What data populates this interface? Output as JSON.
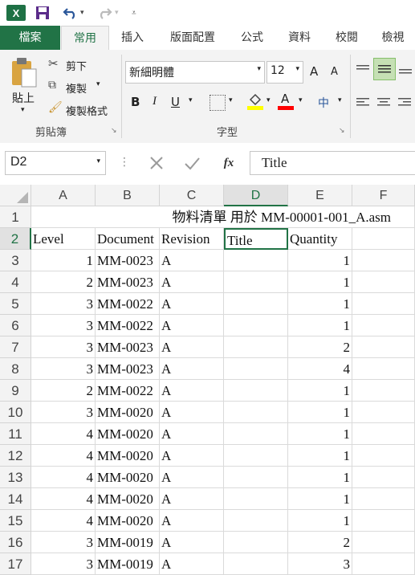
{
  "quick_access": {
    "logo": "X",
    "save_icon": "save-icon",
    "undo_icon": "undo-icon",
    "redo_icon": "redo-icon"
  },
  "tabs": [
    {
      "label": "檔案"
    },
    {
      "label": "常用"
    },
    {
      "label": "插入"
    },
    {
      "label": "版面配置"
    },
    {
      "label": "公式"
    },
    {
      "label": "資料"
    },
    {
      "label": "校閱"
    },
    {
      "label": "檢視"
    }
  ],
  "ribbon": {
    "clipboard": {
      "paste": "貼上",
      "cut": "剪下",
      "copy": "複製",
      "format_painter": "複製格式",
      "group_label": "剪貼簿"
    },
    "font": {
      "name": "新細明體",
      "size": "12",
      "bold": "B",
      "italic": "I",
      "underline": "U",
      "group_label": "字型",
      "phonetic": "中",
      "grow": "A",
      "shrink": "A",
      "font_color": "A"
    }
  },
  "formula_bar": {
    "name_box": "D2",
    "fx": "fx",
    "value": "Title"
  },
  "columns": [
    "A",
    "B",
    "C",
    "D",
    "E",
    "F"
  ],
  "title_row": "物料清單 用於 MM-00001-001_A.asm",
  "headers": [
    "Level",
    "Document",
    "Revision",
    "Title",
    "Quantity"
  ],
  "rows": [
    {
      "n": "3",
      "level": "1",
      "doc": "MM-0023",
      "rev": "A",
      "title": "",
      "qty": "1"
    },
    {
      "n": "4",
      "level": "2",
      "doc": "MM-0023",
      "rev": "A",
      "title": "",
      "qty": "1"
    },
    {
      "n": "5",
      "level": "3",
      "doc": "MM-0022",
      "rev": "A",
      "title": "",
      "qty": "1"
    },
    {
      "n": "6",
      "level": "3",
      "doc": "MM-0022",
      "rev": "A",
      "title": "",
      "qty": "1"
    },
    {
      "n": "7",
      "level": "3",
      "doc": "MM-0023",
      "rev": "A",
      "title": "",
      "qty": "2"
    },
    {
      "n": "8",
      "level": "3",
      "doc": "MM-0023",
      "rev": "A",
      "title": "",
      "qty": "4"
    },
    {
      "n": "9",
      "level": "2",
      "doc": "MM-0022",
      "rev": "A",
      "title": "",
      "qty": "1"
    },
    {
      "n": "10",
      "level": "3",
      "doc": "MM-0020",
      "rev": "A",
      "title": "",
      "qty": "1"
    },
    {
      "n": "11",
      "level": "4",
      "doc": "MM-0020",
      "rev": "A",
      "title": "",
      "qty": "1"
    },
    {
      "n": "12",
      "level": "4",
      "doc": "MM-0020",
      "rev": "A",
      "title": "",
      "qty": "1"
    },
    {
      "n": "13",
      "level": "4",
      "doc": "MM-0020",
      "rev": "A",
      "title": "",
      "qty": "1"
    },
    {
      "n": "14",
      "level": "4",
      "doc": "MM-0020",
      "rev": "A",
      "title": "",
      "qty": "1"
    },
    {
      "n": "15",
      "level": "4",
      "doc": "MM-0020",
      "rev": "A",
      "title": "",
      "qty": "1"
    },
    {
      "n": "16",
      "level": "3",
      "doc": "MM-0019",
      "rev": "A",
      "title": "",
      "qty": "2"
    },
    {
      "n": "17",
      "level": "3",
      "doc": "MM-0019",
      "rev": "A",
      "title": "",
      "qty": "3"
    }
  ],
  "colors": {
    "accent": "#217346",
    "ribbon_bg": "#f3f3f3"
  }
}
